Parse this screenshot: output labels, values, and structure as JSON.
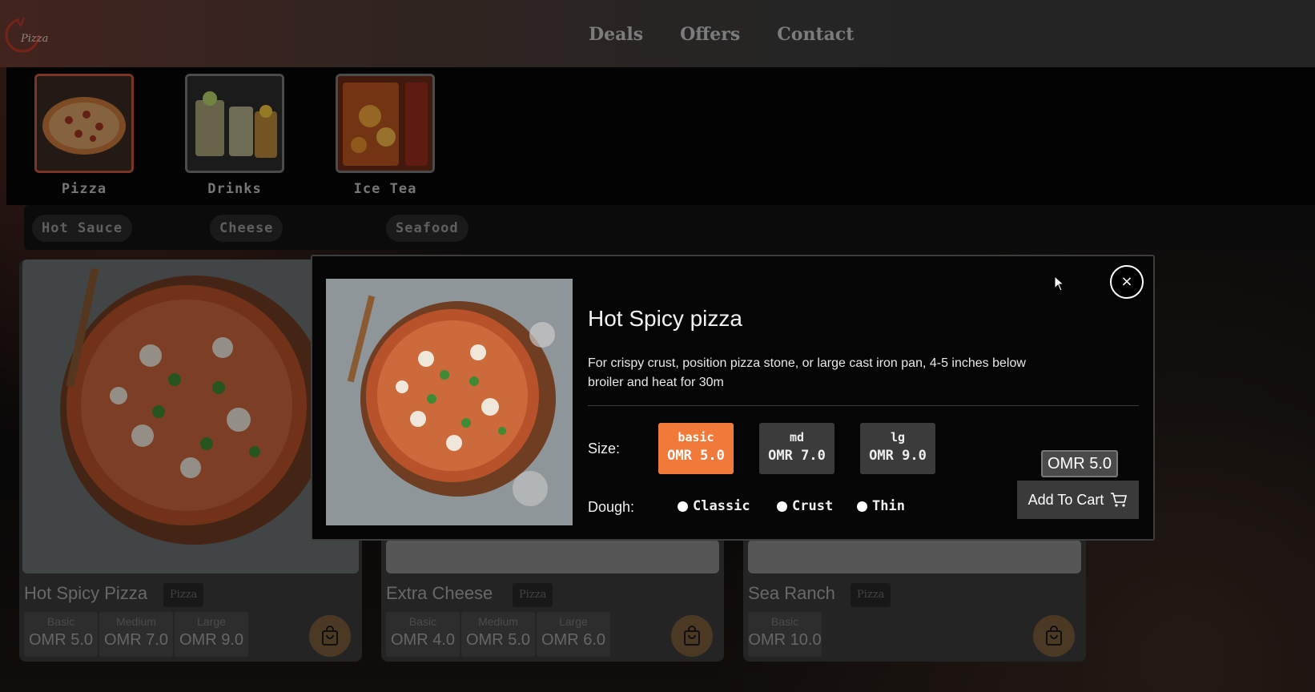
{
  "header": {
    "logo_text": "Pizza",
    "nav": [
      "Deals",
      "Offers",
      "Contact"
    ]
  },
  "categories": [
    {
      "label": "Pizza",
      "icon": "pizza-thumbnail",
      "active": true
    },
    {
      "label": "Drinks",
      "icon": "drinks-thumbnail",
      "active": false
    },
    {
      "label": "Ice Tea",
      "icon": "ice-tea-thumbnail",
      "active": false
    }
  ],
  "tags": [
    "Hot Sauce",
    "Cheese",
    "Seafood"
  ],
  "products": [
    {
      "name": "Hot Spicy Pizza",
      "badge": "Pizza",
      "prices": [
        {
          "label": "Basic",
          "value": "OMR 5.0"
        },
        {
          "label": "Medium",
          "value": "OMR 7.0"
        },
        {
          "label": "Large",
          "value": "OMR 9.0"
        }
      ]
    },
    {
      "name": "Extra Cheese",
      "badge": "Pizza",
      "prices": [
        {
          "label": "Basic",
          "value": "OMR 4.0"
        },
        {
          "label": "Medium",
          "value": "OMR 5.0"
        },
        {
          "label": "Large",
          "value": "OMR 6.0"
        }
      ]
    },
    {
      "name": "Sea Ranch",
      "badge": "Pizza",
      "prices": [
        {
          "label": "Basic",
          "value": "OMR 10.0"
        }
      ]
    }
  ],
  "modal": {
    "close_label": "×",
    "title": "Hot Spicy pizza",
    "description": "For crispy crust, position pizza stone, or large cast iron pan, 4-5 inches below broiler and heat for 30m",
    "size_label": "Size:",
    "sizes": [
      {
        "name": "basic",
        "price": "OMR 5.0",
        "selected": true
      },
      {
        "name": "md",
        "price": "OMR 7.0",
        "selected": false
      },
      {
        "name": "lg",
        "price": "OMR 9.0",
        "selected": false
      }
    ],
    "dough_label": "Dough:",
    "doughs": [
      "Classic",
      "Crust",
      "Thin"
    ],
    "total": "OMR 5.0",
    "add_to_cart": "Add To Cart"
  },
  "colors": {
    "accent": "#f07a3a",
    "modal_bg": "#050505",
    "card_bg": "#3a3a3a"
  }
}
